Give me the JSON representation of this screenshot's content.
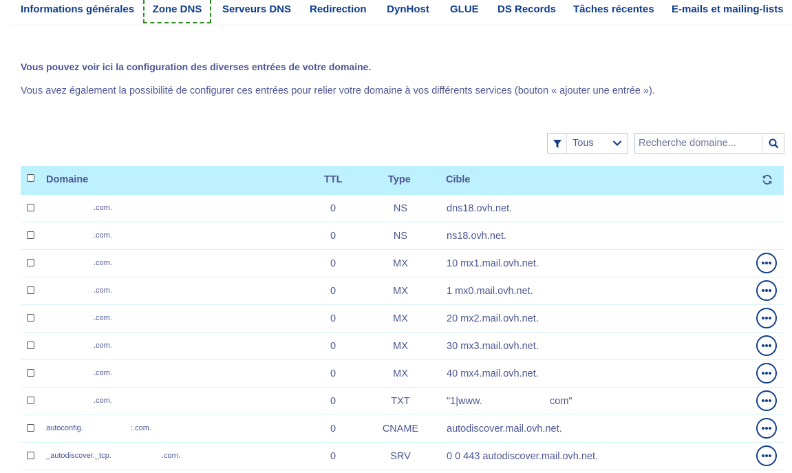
{
  "tabs": [
    {
      "label": "Informations générales",
      "active": false
    },
    {
      "label": "Zone DNS",
      "active": true
    },
    {
      "label": "Serveurs DNS",
      "active": false
    },
    {
      "label": "Redirection",
      "active": false
    },
    {
      "label": "DynHost",
      "active": false
    },
    {
      "label": "GLUE",
      "active": false
    },
    {
      "label": "DS Records",
      "active": false
    },
    {
      "label": "Tâches récentes",
      "active": false
    },
    {
      "label": "E-mails et mailing-lists",
      "active": false
    }
  ],
  "intro": {
    "title": "Vous pouvez voir ici la configuration des diverses entrées de votre domaine.",
    "text": "Vous avez également la possibilité de configurer ces entrées pour relier votre domaine à vos différents services (bouton « ajouter une entrée »)."
  },
  "filter": {
    "value": "Tous",
    "icon": "filter-icon"
  },
  "search": {
    "placeholder": "Recherche domaine...",
    "icon": "search-icon"
  },
  "table": {
    "headers": {
      "domain": "Domaine",
      "ttl": "TTL",
      "type": "Type",
      "target": "Cible"
    },
    "rows": [
      {
        "domain": ".com.",
        "ttl": "0",
        "type": "NS",
        "target": "dns18.ovh.net.",
        "actions": false
      },
      {
        "domain": ".com.",
        "ttl": "0",
        "type": "NS",
        "target": "ns18.ovh.net.",
        "actions": false
      },
      {
        "domain": ".com.",
        "ttl": "0",
        "type": "MX",
        "target": "10 mx1.mail.ovh.net.",
        "actions": true
      },
      {
        "domain": ".com.",
        "ttl": "0",
        "type": "MX",
        "target": "1 mx0.mail.ovh.net.",
        "actions": true
      },
      {
        "domain": ".com.",
        "ttl": "0",
        "type": "MX",
        "target": "20 mx2.mail.ovh.net.",
        "actions": true
      },
      {
        "domain": ".com.",
        "ttl": "0",
        "type": "MX",
        "target": "30 mx3.mail.ovh.net.",
        "actions": true
      },
      {
        "domain": ".com.",
        "ttl": "0",
        "type": "MX",
        "target": "40 mx4.mail.ovh.net.",
        "actions": true
      },
      {
        "domain": ".com.",
        "ttl": "0",
        "type": "TXT",
        "target_parts": [
          "\"1|www.",
          "com\""
        ],
        "actions": true
      },
      {
        "domain_parts": [
          "autoconfig.",
          ":.com."
        ],
        "ttl": "0",
        "type": "CNAME",
        "target": "autodiscover.mail.ovh.net.",
        "actions": true
      },
      {
        "domain_parts": [
          "_autodiscover._tcp.",
          ".com."
        ],
        "ttl": "0",
        "type": "SRV",
        "target": "0 0 443 autodiscover.mail.ovh.net.",
        "actions": true
      }
    ]
  }
}
